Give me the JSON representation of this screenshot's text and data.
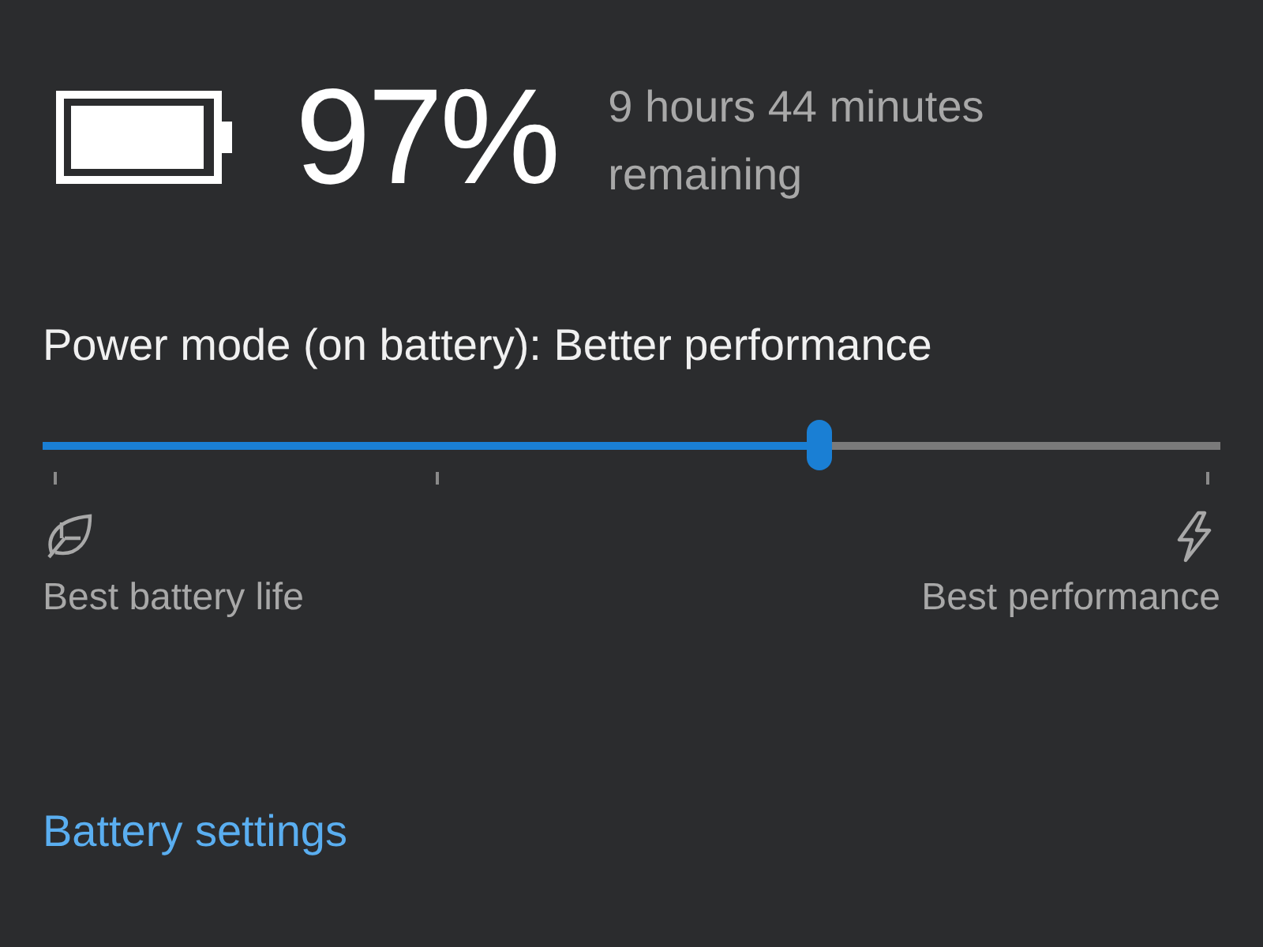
{
  "battery": {
    "percent": "97%",
    "remaining": "9 hours 44 minutes remaining"
  },
  "power_mode": {
    "title": "Power mode (on battery): Better performance",
    "level": 0.66,
    "left_label": "Best battery life",
    "right_label": "Best performance"
  },
  "link": "Battery settings"
}
